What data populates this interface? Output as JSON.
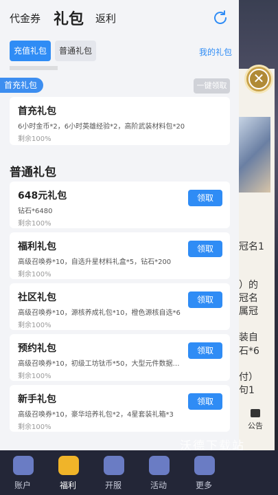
{
  "header": {
    "tabs": [
      {
        "label": "代金券"
      },
      {
        "label": "礼包"
      },
      {
        "label": "返利"
      }
    ]
  },
  "subtabs": [
    {
      "label": "充值礼包"
    },
    {
      "label": "普通礼包"
    }
  ],
  "my_gift_label": "我的礼包",
  "first_recharge": {
    "label": "首充礼包",
    "claim_all": "一键领取",
    "card": {
      "title": "首充礼包",
      "desc": "6小时金币*2，6小时英雄经验*2，高阶武装材料包*20",
      "remain": "剩余100%"
    }
  },
  "normal_section_title": "普通礼包",
  "claim_label": "领取",
  "gifts": [
    {
      "title": "648元礼包",
      "desc": "钻石*6480",
      "remain": "剩余100%"
    },
    {
      "title": "福利礼包",
      "desc": "高级召唤券*10，自选升星材料礼盒*5，钻石*200",
      "remain": "剩余100%"
    },
    {
      "title": "社区礼包",
      "desc": "高级召唤券*10，源核养成礼包*10，橙色源核自选*6",
      "remain": "剩余100%"
    },
    {
      "title": "预约礼包",
      "desc": "高级召唤券*10，初级工坊钛币*50，大型元件数据自...",
      "remain": "剩余100%"
    },
    {
      "title": "新手礼包",
      "desc": "高级召唤券*10，豪华培养礼包*2，4星套装礼箱*3",
      "remain": "剩余100%"
    }
  ],
  "background": {
    "lines": [
      "冠名1",
      "）的",
      "冠名",
      "属冠",
      "装自",
      "石*6",
      "付）",
      "句1"
    ],
    "notice_label": "公告",
    "watermark": "沃德下载站"
  },
  "bottom_nav": [
    {
      "label": "账户",
      "icon": "account-icon"
    },
    {
      "label": "福利",
      "icon": "gift-icon"
    },
    {
      "label": "开服",
      "icon": "gamepad-icon"
    },
    {
      "label": "活动",
      "icon": "controller-icon"
    },
    {
      "label": "更多",
      "icon": "grid-icon"
    }
  ],
  "colors": {
    "accent": "#2f8cf5",
    "panel_bg": "#f3f4f7",
    "nav_bg": "#232637",
    "nav_active": "#f0b429"
  }
}
